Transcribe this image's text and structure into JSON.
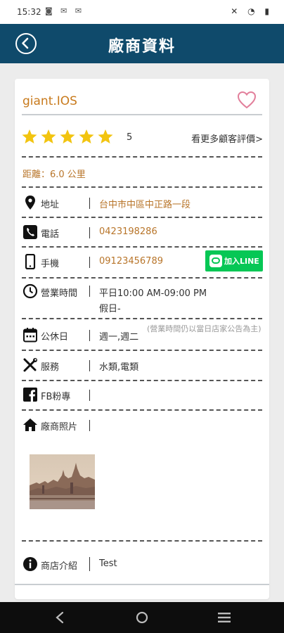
{
  "status_bar": {
    "time": "15:32",
    "left_icons": "◙ ✉ ✉",
    "right_icons": "✕ ◔ ▮"
  },
  "header": {
    "title": "廠商資料"
  },
  "shop": {
    "name": "giant.IOS",
    "rating": "5",
    "rating_value": 5,
    "more_reviews": "看更多顧客評價>",
    "distance": "距離：6.0 公里"
  },
  "info": {
    "address_label": "地址",
    "address": "台中市中區中正路一段",
    "phone_label": "電話",
    "phone": "0423198286",
    "mobile_label": "手機",
    "mobile": "09123456789",
    "line_button": "加入LINE",
    "hours_label": "營業時間",
    "hours_weekday": "平日10:00 AM-09:00 PM",
    "hours_holiday": "假日-",
    "closed_label": "公休日",
    "closed_days": "週一,週二",
    "closed_note": "(營業時間仍以當日店家公告為主)",
    "service_label": "服務",
    "services": "水類,電類",
    "fb_label": "FB粉專",
    "fb_value": "",
    "photos_label": "廠商照片",
    "intro_label": "商店介紹",
    "intro": "Test"
  },
  "colors": {
    "header_bg": "#0f4a6b",
    "accent_orange": "#c87a1c",
    "line_green": "#06c755",
    "star": "#f2c410"
  }
}
